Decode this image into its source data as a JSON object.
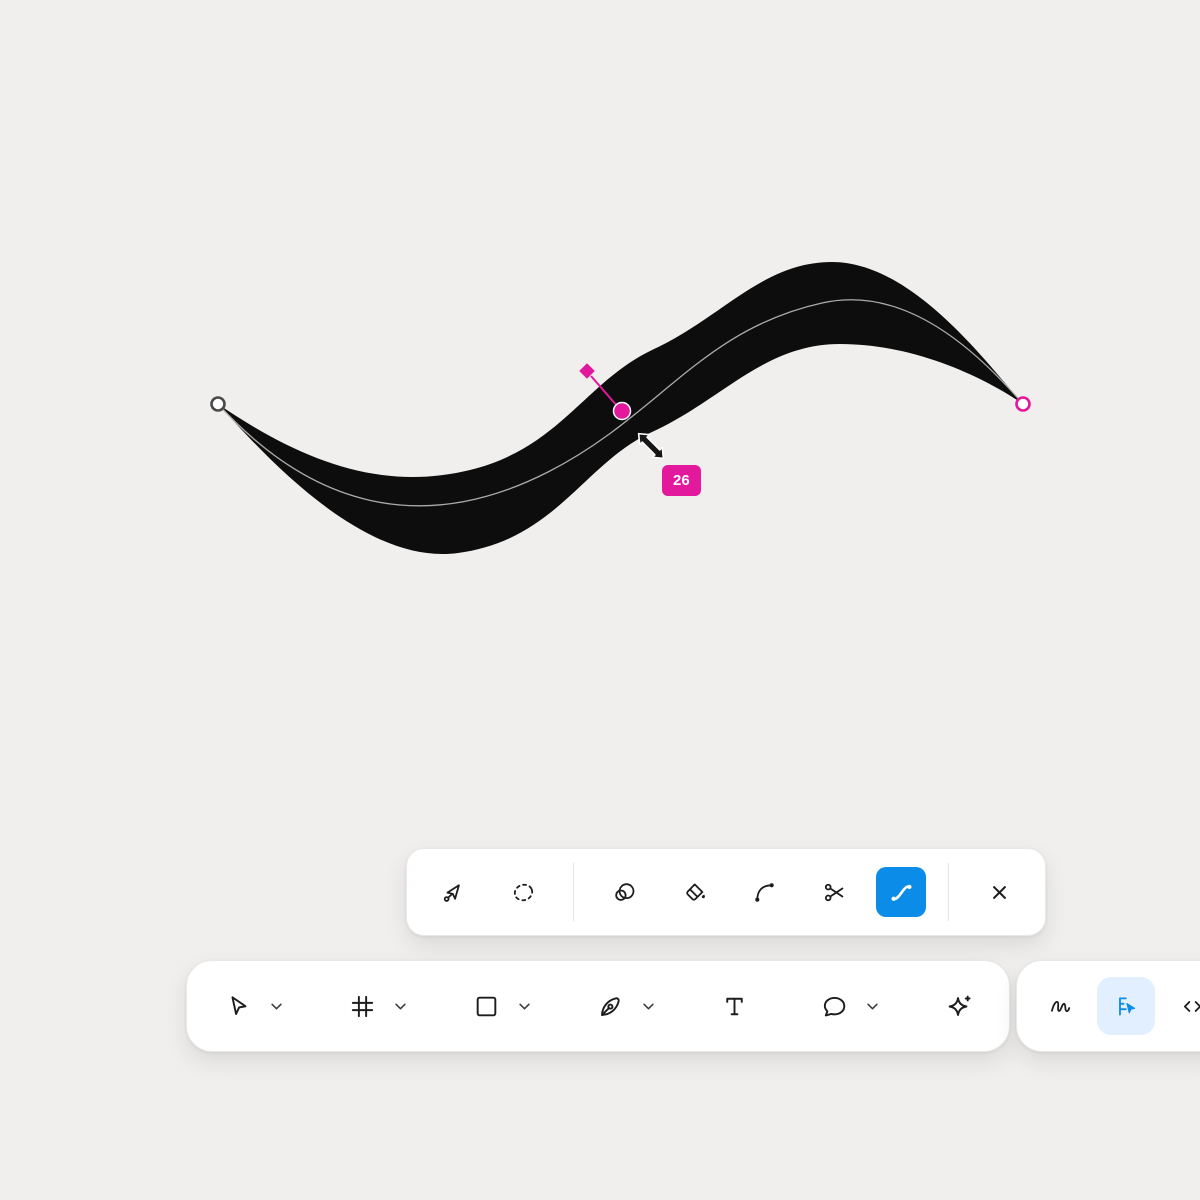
{
  "canvas": {
    "width_badge": "26",
    "colors": {
      "accent": "#E2189D",
      "shape": "#0D0D0D",
      "spine": "#ABABAB",
      "background": "#F0EFEE",
      "selection_blue": "#0C8CE9",
      "selection_soft_blue": "#E1EFFF"
    },
    "elements": [
      "vector-shape",
      "path-spine",
      "anchor-point-left",
      "anchor-point-right",
      "width-control-point",
      "width-handle-diamond",
      "resize-cursor"
    ]
  },
  "vector_toolbar": {
    "groups": [
      {
        "tools": [
          {
            "icon": "vector-select"
          },
          {
            "icon": "lasso"
          }
        ]
      },
      {
        "tools": [
          {
            "icon": "paint-regions"
          },
          {
            "icon": "paint-bucket"
          },
          {
            "icon": "bend-arc"
          },
          {
            "icon": "scissors"
          },
          {
            "icon": "width-tool",
            "selected": true
          }
        ]
      },
      {
        "tools": [
          {
            "icon": "close"
          }
        ]
      }
    ]
  },
  "main_toolbar": {
    "tools": [
      {
        "icon": "move-cursor",
        "dropdown": true
      },
      {
        "icon": "frame",
        "dropdown": true
      },
      {
        "icon": "rectangle",
        "dropdown": true
      },
      {
        "icon": "pen",
        "dropdown": true
      },
      {
        "icon": "text",
        "dropdown": false
      },
      {
        "icon": "comment",
        "dropdown": true
      },
      {
        "icon": "sparkle-plus",
        "dropdown": false
      }
    ]
  },
  "side_toolbar": {
    "tools": [
      {
        "icon": "scribble",
        "dropdown": false
      },
      {
        "icon": "draw-ruler",
        "selected": true
      },
      {
        "icon": "code",
        "dropdown": false
      }
    ]
  },
  "icons": {
    "vector-select": "cursor arrow with node handle",
    "lasso": "dashed circle",
    "paint-regions": "two overlapping circles",
    "paint-bucket": "tilted bucket with drop",
    "bend-arc": "arc with end nodes",
    "scissors": "scissors",
    "width-tool": "variable width stroke with nodes",
    "close": "x mark",
    "move-cursor": "arrow cursor",
    "frame": "hash grid",
    "rectangle": "square outline",
    "pen": "pen nib",
    "text": "letter T",
    "comment": "speech bubble",
    "sparkle-plus": "four point star with plus",
    "scribble": "marker squiggle",
    "draw-ruler": "ruler with cursor",
    "code": "angle brackets",
    "chevron-down": "small down chevron",
    "resize-cursor": "diagonal double arrow"
  }
}
